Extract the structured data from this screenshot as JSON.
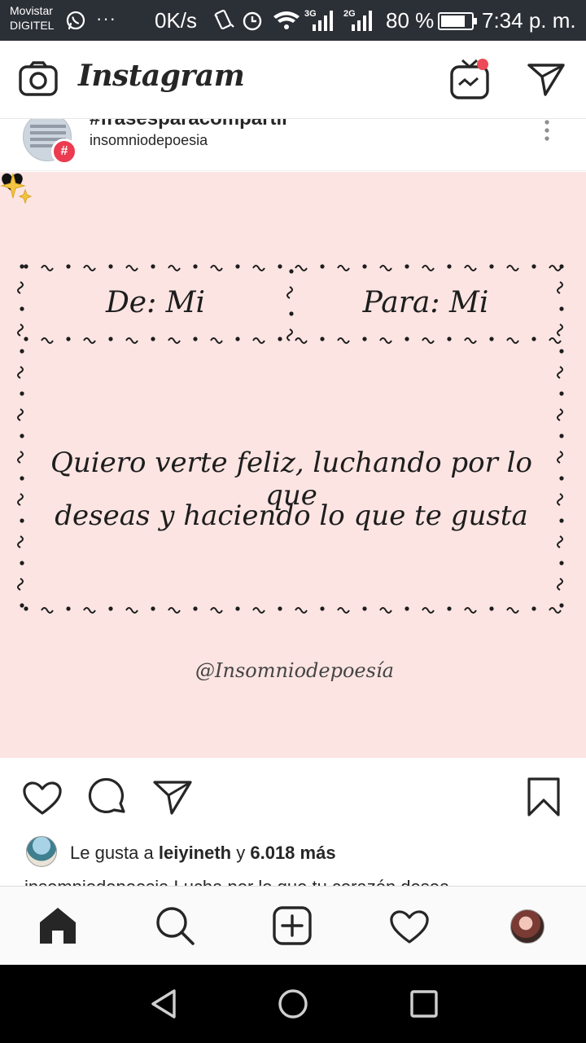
{
  "status_bar": {
    "carrier_line1": "Movistar",
    "carrier_line2": "DIGITEL",
    "speed": "0K/s",
    "net1": "3G",
    "net2": "2G",
    "battery_pct": "80 %",
    "battery_level": 0.8,
    "time": "7:34 p. m."
  },
  "app_bar": {
    "logo": "Instagram",
    "icons": [
      "camera-icon",
      "igtv-icon",
      "direct-message-icon"
    ],
    "notification_color": "#ed4956"
  },
  "post": {
    "hashtag_title": "#frasesparacompartir",
    "username": "insomniodepoesia",
    "badge": "#",
    "image": {
      "background": "#fbe4e2",
      "from_label": "De: Mi",
      "to_label": "Para: Mi",
      "message_line1": "Quiero verte feliz, luchando por lo que",
      "message_line2": "deseas y haciendo lo que te gusta",
      "signature": "@Insomniodepoesía"
    },
    "likes": {
      "prefix": "Le gusta a ",
      "user": "leiyineth",
      "joiner": " y ",
      "count": "6.018 más"
    },
    "caption_preview": "insomniodepoesia Lucha por lo que tu corazón desea"
  },
  "bottom_nav": [
    "home-icon",
    "search-icon",
    "new-post-icon",
    "activity-heart-icon",
    "profile-avatar"
  ]
}
